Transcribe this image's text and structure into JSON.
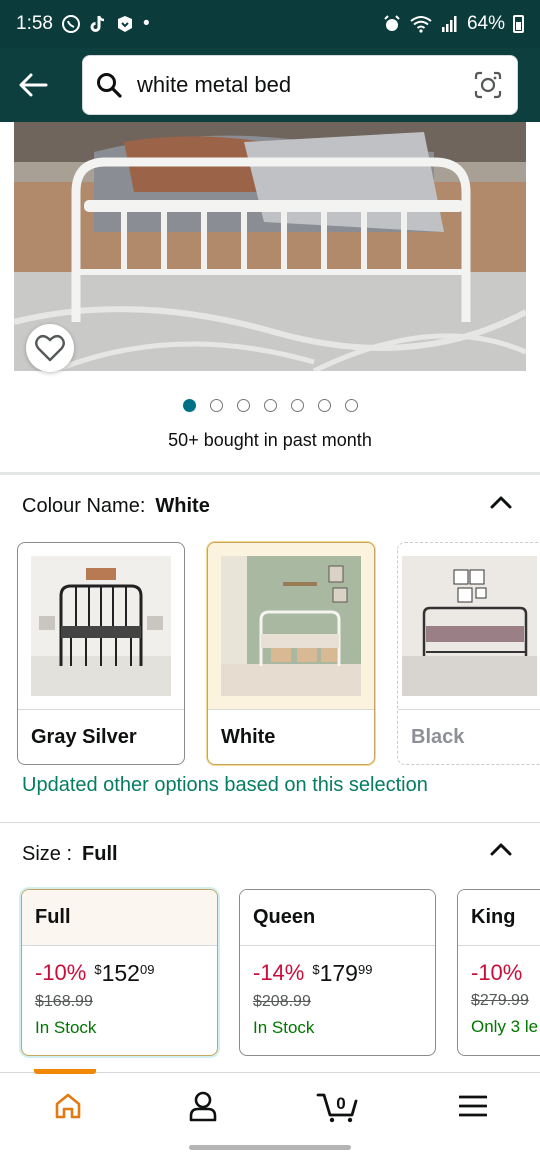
{
  "status_bar": {
    "time": "1:58",
    "battery": "64%",
    "dot": "•"
  },
  "search": {
    "query": "white metal bed"
  },
  "gallery": {
    "total_images": 7,
    "active_index": 0
  },
  "bought_text": "50+ bought in past month",
  "colour_section": {
    "label": "Colour Name:",
    "value": "White",
    "options": [
      {
        "name": "Gray Silver",
        "selected": false
      },
      {
        "name": "White",
        "selected": true
      },
      {
        "name": "Black",
        "selected": false
      }
    ],
    "updated_note": "Updated other options based on this selection"
  },
  "size_section": {
    "label": "Size :",
    "value": "Full",
    "options": [
      {
        "name": "Full",
        "discount": "-10%",
        "currency": "$",
        "price_whole": "152",
        "price_fraction": "09",
        "list_price": "$168.99",
        "stock": "In Stock"
      },
      {
        "name": "Queen",
        "discount": "-14%",
        "currency": "$",
        "price_whole": "179",
        "price_fraction": "99",
        "list_price": "$208.99",
        "stock": "In Stock"
      },
      {
        "name": "King",
        "discount": "-10%",
        "list_price": "$279.99",
        "stock": "Only 3 le"
      }
    ]
  },
  "bottom_nav": {
    "cart_count": "0"
  },
  "colors": {
    "header_bg": "#0e3f3f",
    "accent_teal": "#007185",
    "discount_red": "#cc0c39",
    "stock_green": "#007600",
    "note_green": "#067d62",
    "nav_active": "#f08804"
  }
}
